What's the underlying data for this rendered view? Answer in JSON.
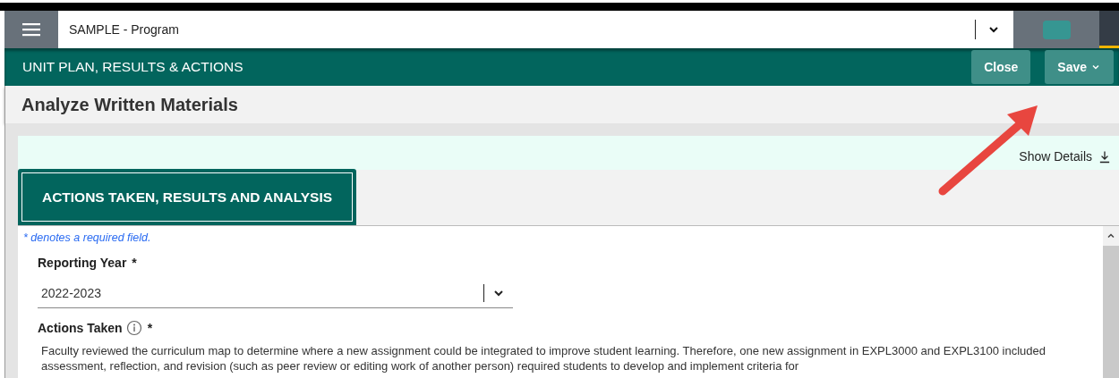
{
  "program_select": {
    "value": "SAMPLE - Program"
  },
  "header": {
    "title": "UNIT PLAN, RESULTS & ACTIONS",
    "buttons": [
      {
        "label": "Close",
        "kind": "plain"
      },
      {
        "label": "Save",
        "kind": "menu"
      }
    ]
  },
  "page_title": "Analyze Written Materials",
  "show_details": "Show Details",
  "tabs": [
    {
      "label": "ACTIONS TAKEN, RESULTS AND ANALYSIS",
      "selected": true
    }
  ],
  "required_note": "* denotes a required field.",
  "fields": [
    {
      "kind": "select",
      "label": "Reporting Year",
      "required_mark": "*",
      "value": "2022-2023"
    },
    {
      "kind": "text",
      "label": "Actions Taken",
      "required_mark": "*",
      "info": true,
      "value": "Faculty reviewed the curriculum map to determine where a new assignment could be integrated to improve student learning. Therefore, one new assignment in EXPL3000 and EXPL3100 included assessment, reflection, and revision (such as peer review or editing work of another person) required students to develop and implement criteria for"
    }
  ]
}
